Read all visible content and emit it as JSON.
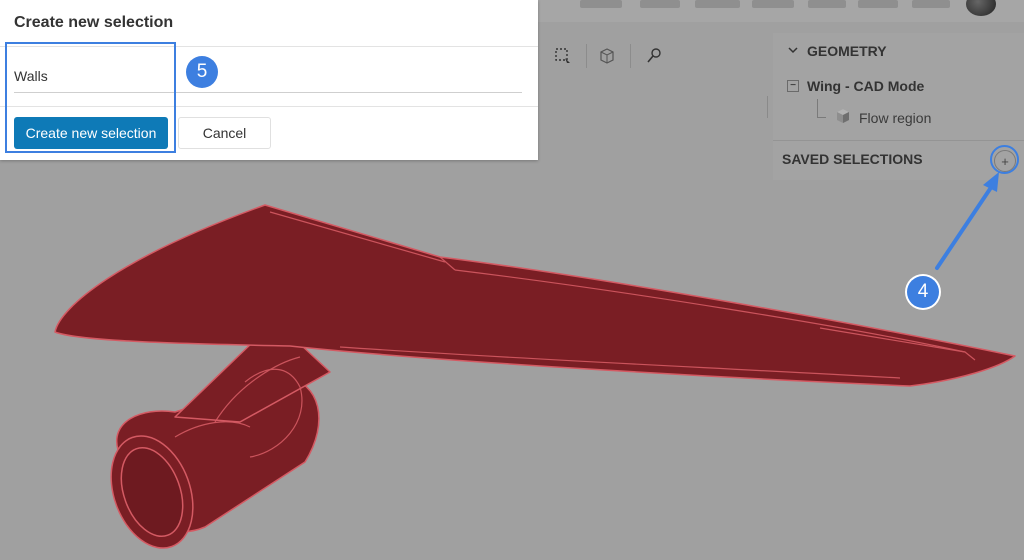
{
  "dialog": {
    "title": "Create new selection",
    "input_value": "Walls",
    "create_label": "Create new selection",
    "cancel_label": "Cancel"
  },
  "tree": {
    "geometry_label": "GEOMETRY",
    "model_label": "Wing - CAD Mode",
    "region_label": "Flow region",
    "saved_selections_label": "SAVED SELECTIONS",
    "add_symbol": "+"
  },
  "annotations": {
    "step_4": "4",
    "step_5": "5",
    "color": "#3d7fe0"
  },
  "model": {
    "color": "#7a1e24",
    "edge_color": "#d45a63"
  },
  "icons": [
    "box-select-icon",
    "mesh-icon",
    "probe-icon",
    "chevron-down-icon",
    "cube-icon"
  ]
}
